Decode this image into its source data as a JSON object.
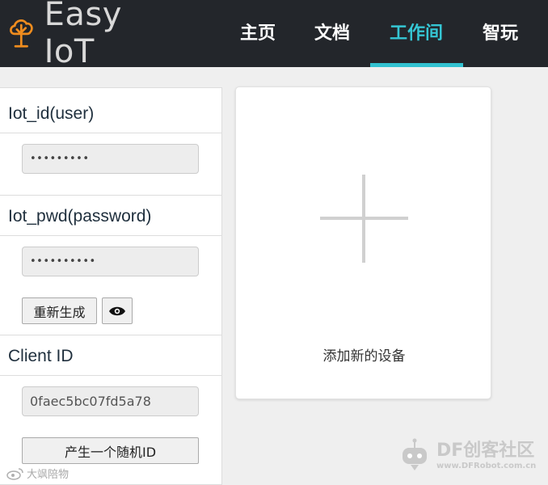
{
  "header": {
    "logo_text": "Easy IoT",
    "nav": [
      {
        "label": "主页"
      },
      {
        "label": "文档"
      },
      {
        "label": "工作间"
      },
      {
        "label": "智玩"
      }
    ],
    "active_index": 2,
    "accent_color": "#31c1d0"
  },
  "left_panel": {
    "iot_id": {
      "title": "Iot_id(user)",
      "value": "•••••••••"
    },
    "iot_pwd": {
      "title": "Iot_pwd(password)",
      "value": "••••••••••"
    },
    "regenerate_label": "重新生成",
    "show_password_icon": "eye-icon",
    "client_id": {
      "title": "Client ID",
      "value": "0faec5bc07fd5a78"
    },
    "random_id_label": "产生一个随机ID"
  },
  "add_device": {
    "icon": "plus-icon",
    "label": "添加新的设备"
  },
  "watermarks": {
    "left_text": "大飒陪物",
    "right_brand": "DF创客社区",
    "right_url": "www.DFRobot.com.cn"
  }
}
